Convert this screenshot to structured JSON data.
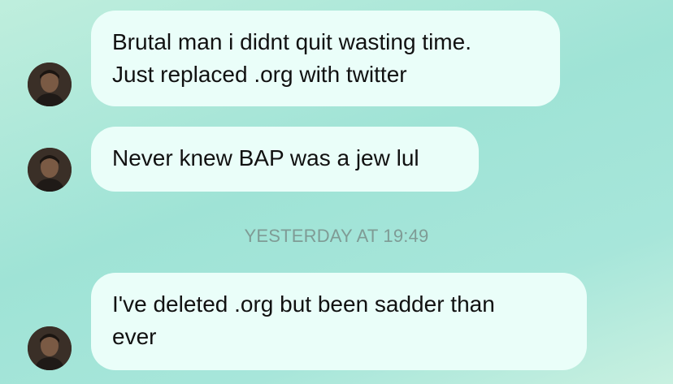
{
  "messages": [
    {
      "lines": [
        "Brutal man i didnt quit wasting time.",
        "Just replaced .org with twitter"
      ]
    },
    {
      "lines": [
        "Never knew BAP was a jew lul"
      ]
    },
    {
      "lines": [
        "I've deleted .org but been sadder than",
        "ever"
      ]
    }
  ],
  "timestamp": "YESTERDAY AT 19:49",
  "icons": {
    "avatar": "profile-photo-avatar-icon"
  },
  "colors": {
    "bubble": "#eafef9",
    "timestamp": "#7f9b95",
    "text": "#111111"
  }
}
